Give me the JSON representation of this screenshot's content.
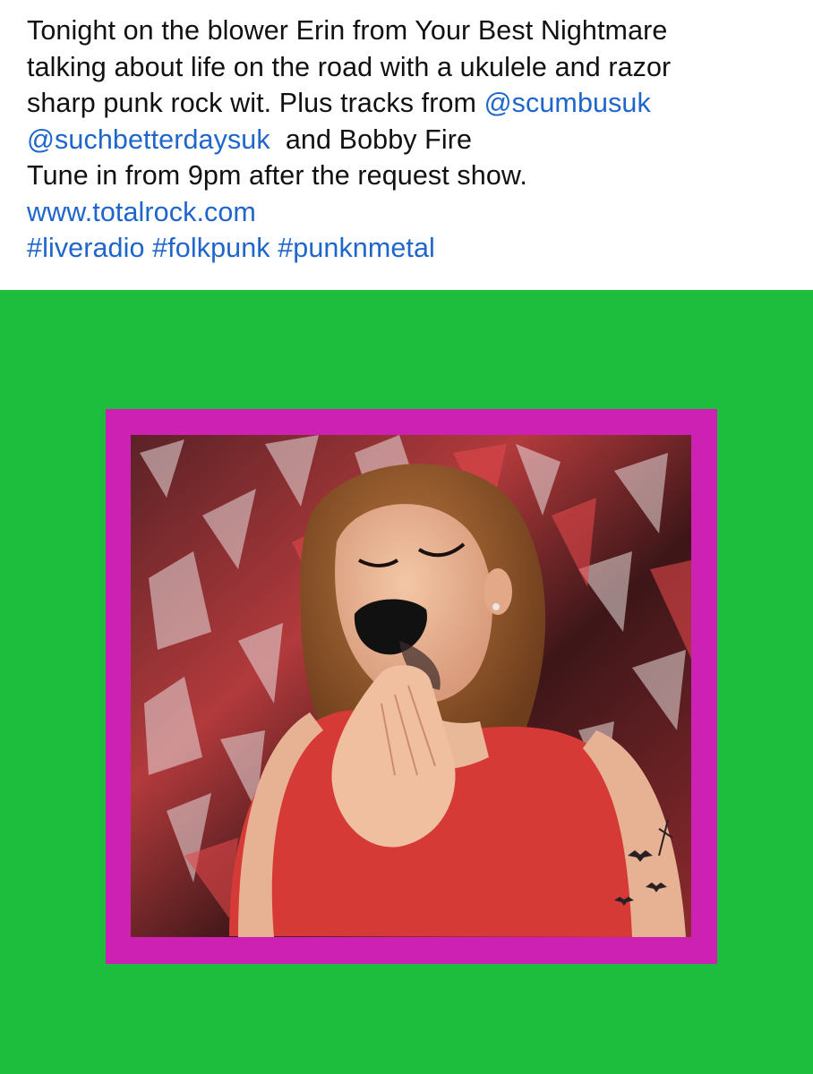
{
  "post": {
    "line1": "Tonight on the blower Erin from Your Best Nightmare",
    "line2": "talking about life on the road with a ukulele and razor",
    "line3_text": "sharp punk rock wit. Plus tracks from ",
    "mention1": "@scumbusuk",
    "mention2": "@suchbetterdaysuk",
    "line4_text": "  and Bobby Fire",
    "line5": "Tune in from 9pm after the request show.",
    "url": "www.totalrock.com",
    "hashtags": [
      "#liveradio",
      "#folkpunk",
      "#punknmetal"
    ]
  },
  "colors": {
    "text": "#111111",
    "link": "#1f66cc",
    "background_green": "#1dbd3e",
    "frame_magenta": "#cc21b3",
    "top_red": "#e2322e"
  },
  "image": {
    "subject": "woman-with-black-lipstick-red-top",
    "backdrop": "red-silver-foil-curtain",
    "details": [
      "tattoo-bats",
      "hand-at-chin"
    ]
  }
}
